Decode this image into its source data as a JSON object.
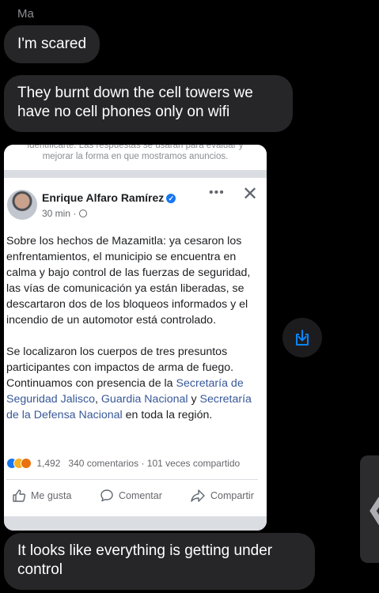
{
  "conversation": {
    "sender_name": "Ma",
    "messages": [
      {
        "text": "I'm scared"
      },
      {
        "text": "They burnt down the cell towers we have no cell phones only on wifi"
      },
      {
        "text": "It looks like everything is getting under control"
      }
    ]
  },
  "screenshot": {
    "top_text_line1": "identificarte. Las respuestas se usarán para evaluar y",
    "top_text_line2": "mejorar la forma en que mostramos anuncios.",
    "post": {
      "author": "Enrique Alfaro Ramírez",
      "time": "30 min ·",
      "paragraph1": "Sobre los hechos de Mazamitla: ya cesaron los enfrentamientos, el municipio se encuentra en calma y bajo control de las fuerzas de seguridad, las vías de comunicación ya están liberadas, se descartaron dos de los bloqueos informados y el incendio de un automotor está controlado.",
      "paragraph2": "Se localizaron los cuerpos de tres presuntos participantes con impactos de arma de fuego. Continuamos con presencia de la ",
      "link1": "Secretaría de Seguridad Jalisco",
      "sep1": ", ",
      "link2": "Guardia Nacional",
      "sep2": " y ",
      "link3": "Secretaría de la Defensa Nacional",
      "tail": " en toda la región.",
      "reaction_count": "1,492",
      "comments": "340 comentarios",
      "shares": "101 veces compartido",
      "dot": "·",
      "more_label": "•••",
      "close_label": "✕",
      "like_label": "Me gusta",
      "comment_label": "Comentar",
      "share_label": "Compartir"
    }
  },
  "icons": {
    "download": "download-icon",
    "edge_tab": "chevron-left-icon",
    "edge_tab_glyph": "❮"
  },
  "colors": {
    "bubble": "#262628",
    "link": "#385898",
    "accent": "#0a84ff"
  }
}
